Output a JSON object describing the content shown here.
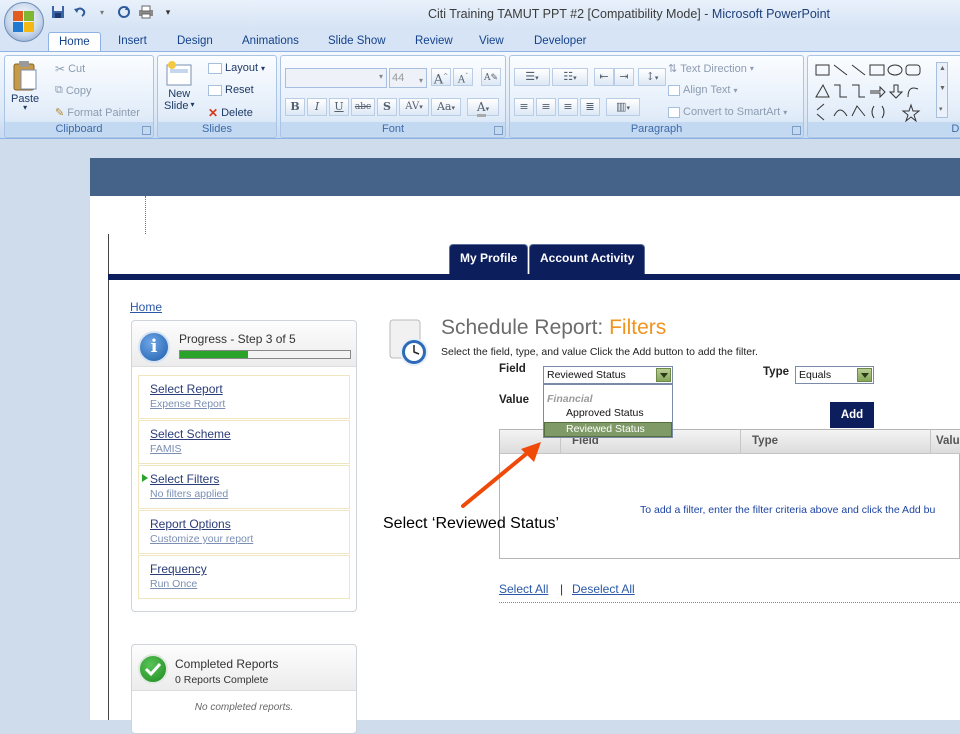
{
  "window": {
    "title_doc": "Citi Training TAMUT PPT #2 [Compatibility Mode]",
    "title_sep": " - ",
    "title_app": "Microsoft PowerPoint"
  },
  "ribbon": {
    "tabs": [
      "Home",
      "Insert",
      "Design",
      "Animations",
      "Slide Show",
      "Review",
      "View",
      "Developer"
    ],
    "active_tab": "Home",
    "clipboard": {
      "label": "Clipboard",
      "paste": "Paste",
      "cut": "Cut",
      "copy": "Copy",
      "format_painter": "Format Painter"
    },
    "slides": {
      "label": "Slides",
      "new_slide_1": "New",
      "new_slide_2": "Slide",
      "layout": "Layout",
      "reset": "Reset",
      "delete": "Delete"
    },
    "font": {
      "label": "Font",
      "size": "44",
      "bold": "B",
      "italic": "I",
      "underline": "U",
      "strike": "abc",
      "shadow": "S",
      "spacing": "AV",
      "case": "Aa",
      "color": "A",
      "grow": "A",
      "shrink": "A"
    },
    "paragraph": {
      "label": "Paragraph",
      "text_direction": "Text Direction",
      "align_text": "Align Text",
      "convert_smartart": "Convert to SmartArt"
    },
    "drawing": {
      "label": "Dr"
    }
  },
  "web": {
    "nav_tabs": [
      "My Profile",
      "Account Activity"
    ],
    "home_link": "Home",
    "progress": {
      "title": "Progress - Step 3 of 5",
      "fraction": 0.4,
      "steps": [
        {
          "title": "Select Report",
          "sub": "Expense Report"
        },
        {
          "title": "Select Scheme",
          "sub": "FAMIS"
        },
        {
          "title": "Select Filters",
          "sub": "No filters applied"
        },
        {
          "title": "Report Options",
          "sub": "Customize your report"
        },
        {
          "title": "Frequency",
          "sub": "Run Once"
        }
      ],
      "current_step": 2
    },
    "completed": {
      "title": "Completed Reports",
      "sub": "0 Reports Complete",
      "empty": "No completed reports."
    },
    "schedule": {
      "title_main": "Schedule Report: ",
      "title_accent": "Filters",
      "instruction": "Select the field, type, and value Click the Add button to add the filter."
    },
    "form": {
      "field_label": "Field",
      "field_value": "Reviewed Status",
      "type_label": "Type",
      "type_value": "Equals",
      "value_label": "Value",
      "add_button": "Add",
      "dropdown_group": "Financial",
      "dropdown_options": [
        "Approved Status",
        "Reviewed Status"
      ]
    },
    "table": {
      "headers": [
        "Field",
        "Type",
        "Valu"
      ],
      "empty_message": "To add a filter, enter the filter criteria above and click the Add bu"
    },
    "select_all": "Select All",
    "separator": "|",
    "deselect_all": "Deselect All"
  },
  "annotation": {
    "callout": "Select ‘Reviewed Status’",
    "arrow_color": "#f04a0a"
  }
}
